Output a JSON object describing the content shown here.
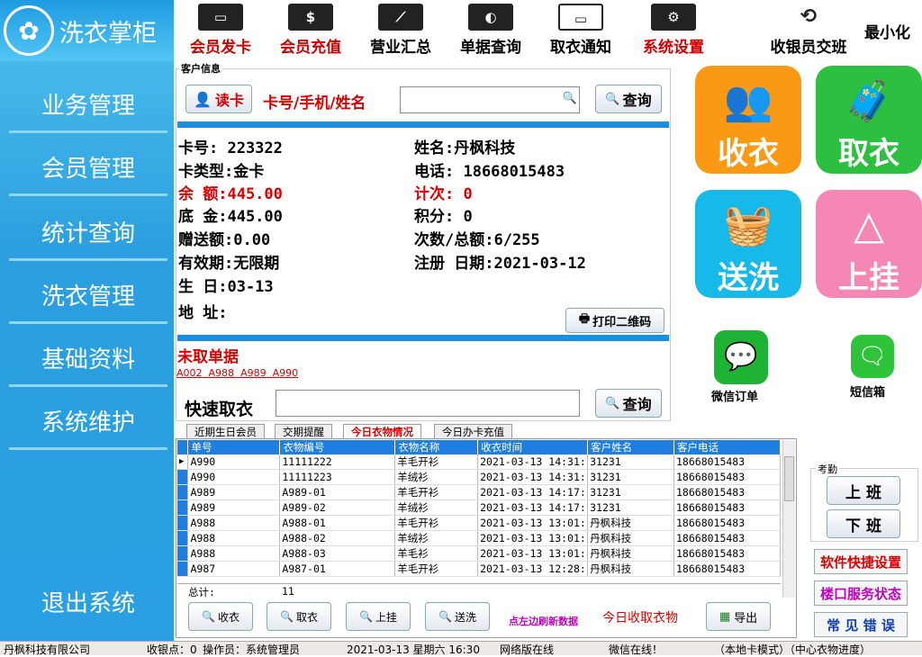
{
  "app": {
    "title": "洗衣掌柜",
    "minimize": "最小化"
  },
  "sidebar": {
    "items": [
      "业务管理",
      "会员管理",
      "统计查询",
      "洗衣管理",
      "基础资料",
      "系统维护"
    ],
    "exit": "退出系统"
  },
  "toolbar": [
    {
      "label": "会员发卡",
      "icon": "card-icon",
      "red": true
    },
    {
      "label": "会员充值",
      "icon": "cash-icon",
      "red": true
    },
    {
      "label": "营业汇总",
      "icon": "chart-icon",
      "red": false
    },
    {
      "label": "单据查询",
      "icon": "document-icon",
      "red": false
    },
    {
      "label": "取衣通知",
      "icon": "message-icon",
      "red": false
    },
    {
      "label": "系统设置",
      "icon": "settings-icon",
      "red": true
    }
  ],
  "cashier": "收银员交班",
  "customer": {
    "section": "客户信息",
    "read_card": "读卡",
    "search_label": "卡号/手机/姓名",
    "search_value": "",
    "query": "查询",
    "card_no": "卡号:  223322",
    "card_type": "卡类型:金卡",
    "balance": "余  额:445.00",
    "base": "底  金:445.00",
    "gift": "赠送额:0.00",
    "validity": "有效期:无限期",
    "birthday": "生  日:03-13",
    "address": "地  址:",
    "name": "姓名:丹枫科技",
    "phone": "电话: 18668015483",
    "count": "计次: 0",
    "points": "积分: 0",
    "times": "次数/总额:6/255",
    "reg": "注册 日期:2021-03-12",
    "print_qr": "打印二维码"
  },
  "untaken": {
    "title": "未取单据",
    "ids": [
      "A002",
      "A988",
      "A989",
      "A990"
    ]
  },
  "quick": {
    "label": "快速取衣",
    "query": "查询"
  },
  "tiles": [
    {
      "label": "收衣"
    },
    {
      "label": "取衣"
    },
    {
      "label": "送洗"
    },
    {
      "label": "上挂"
    }
  ],
  "apps": {
    "wechat": "微信订单",
    "sms": "短信箱"
  },
  "attendance": {
    "title": "考勤",
    "on": "上  班",
    "off": "下  班"
  },
  "right_links": [
    "软件快捷设置",
    "楼口服务状态",
    "常 见 错 误"
  ],
  "tabs": [
    "近期生日会员",
    "交期提醒",
    "今日衣物情况",
    "今日办卡充值"
  ],
  "table": {
    "headers": [
      "单号",
      "衣物编号",
      "衣物名称",
      "收衣时间",
      "客户姓名",
      "客户电话"
    ],
    "rows": [
      [
        "A990",
        "11111222",
        "羊毛开衫",
        "2021-03-13 14:31:",
        "31231",
        "18668015483"
      ],
      [
        "A990",
        "11111223",
        "羊绒衫",
        "2021-03-13 14:31:",
        "31231",
        "18668015483"
      ],
      [
        "A989",
        "A989-01",
        "羊毛开衫",
        "2021-03-13 14:17:",
        "31231",
        "18668015483"
      ],
      [
        "A989",
        "A989-02",
        "羊绒衫",
        "2021-03-13 14:17:",
        "31231",
        "18668015483"
      ],
      [
        "A988",
        "A988-01",
        "羊毛开衫",
        "2021-03-13 13:01:",
        "丹枫科技",
        "18668015483"
      ],
      [
        "A988",
        "A988-02",
        "羊绒衫",
        "2021-03-13 13:01:",
        "丹枫科技",
        "18668015483"
      ],
      [
        "A988",
        "A988-03",
        "羊毛衫",
        "2021-03-13 13:01:",
        "丹枫科技",
        "18668015483"
      ],
      [
        "A987",
        "A987-01",
        "羊毛开衫",
        "2021-03-13 12:28:",
        "丹枫科技",
        "18668015483"
      ]
    ],
    "total_label": "总计:",
    "total_value": "11"
  },
  "bottom": {
    "buttons": [
      "收衣",
      "取衣",
      "上挂",
      "送洗"
    ],
    "refresh": "点左边刷新数据",
    "today": "今日收取衣物",
    "export": "导出"
  },
  "status": {
    "company": "丹枫科技有限公司",
    "point": "收银点：0",
    "operator": "操作员：系统管理员",
    "datetime": "2021-03-13  星期六 16:30",
    "net": "网络版在线",
    "wechat": "微信在线！",
    "mode": "（本地卡模式）（中心衣物进度）"
  }
}
